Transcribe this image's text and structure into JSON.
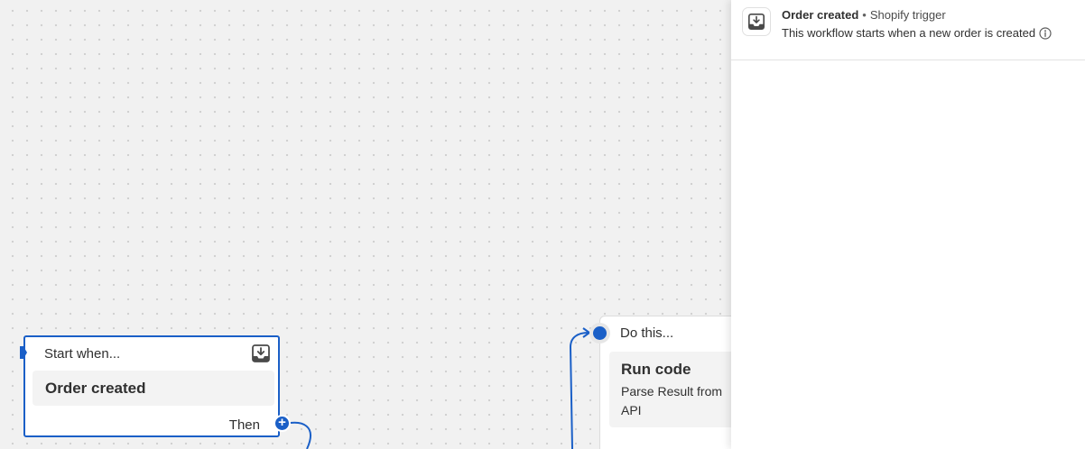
{
  "canvas": {
    "trigger_node": {
      "header": "Start when...",
      "title": "Order created",
      "then_label": "Then",
      "icon": "download-tray-icon",
      "add_button_label": "+"
    },
    "action_node": {
      "header": "Do this...",
      "title": "Run code",
      "description": "Parse Result from API"
    }
  },
  "side_panel": {
    "title": "Order created",
    "separator": "•",
    "trigger_type": "Shopify trigger",
    "description": "This workflow starts when a new order is created",
    "icon": "download-tray-icon",
    "info_icon": "info-icon"
  },
  "colors": {
    "accent": "#1a5fc7",
    "canvas_bg": "#f1f1f1",
    "text": "#303030"
  }
}
